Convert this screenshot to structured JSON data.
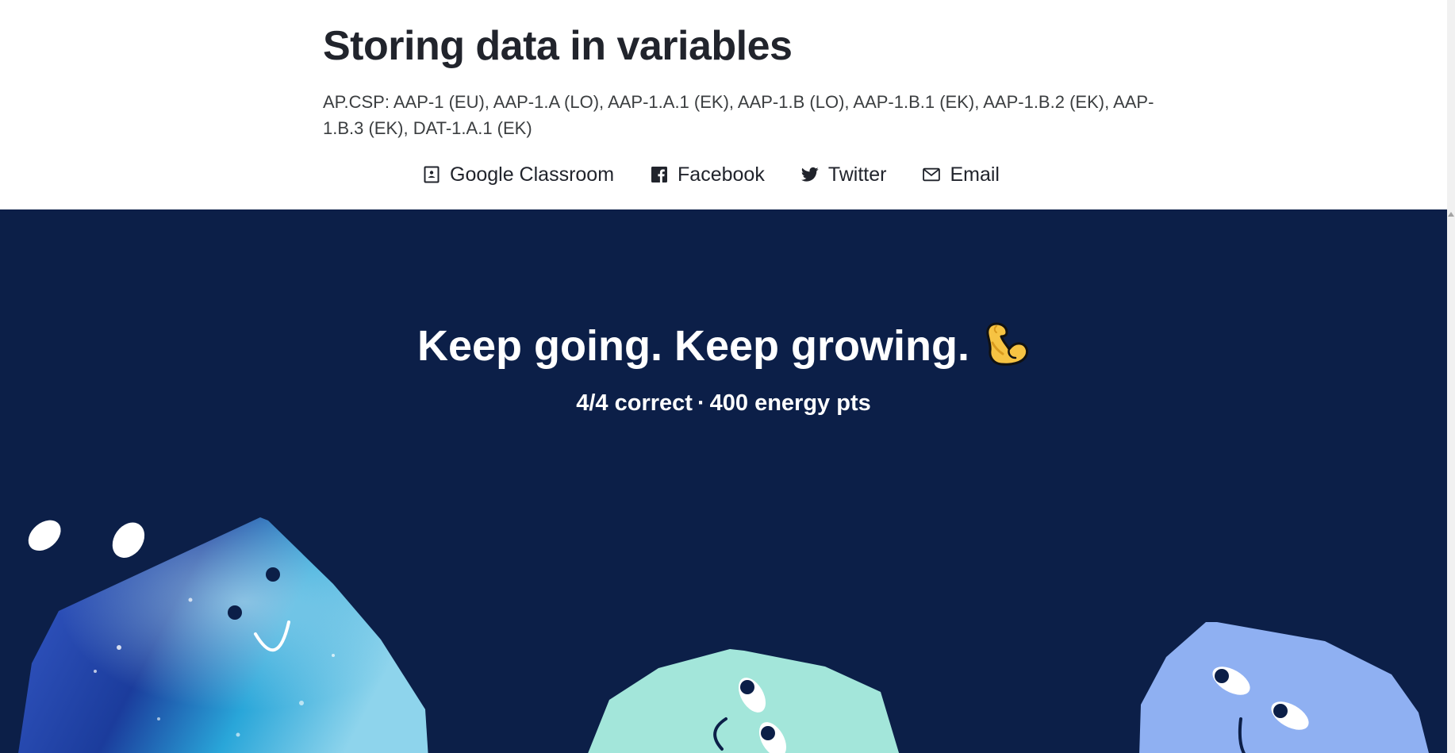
{
  "header": {
    "title": "Storing data in variables",
    "standards": "AP.CSP: AAP-1 (EU), AAP-1.A (LO), AAP-1.A.1 (EK), AAP-1.B (LO), AAP-1.B.1 (EK), AAP-1.B.2 (EK), AAP-1.B.3 (EK), DAT-1.A.1 (EK)"
  },
  "share": [
    {
      "label": "Google Classroom",
      "icon": "google-classroom-icon"
    },
    {
      "label": "Facebook",
      "icon": "facebook-icon"
    },
    {
      "label": "Twitter",
      "icon": "twitter-icon"
    },
    {
      "label": "Email",
      "icon": "email-icon"
    }
  ],
  "hero": {
    "headline": "Keep going. Keep growing.",
    "emoji": "flexed-biceps-emoji",
    "correct": "4/4 correct",
    "separator": "·",
    "energy": "400 energy pts",
    "background_color": "#0c1f48"
  },
  "characters": [
    {
      "name": "galaxy-blob",
      "color": "#2f6fd1"
    },
    {
      "name": "mint-blob",
      "color": "#a3e6da"
    },
    {
      "name": "periwinkle-blob",
      "color": "#8fb0f2"
    }
  ]
}
